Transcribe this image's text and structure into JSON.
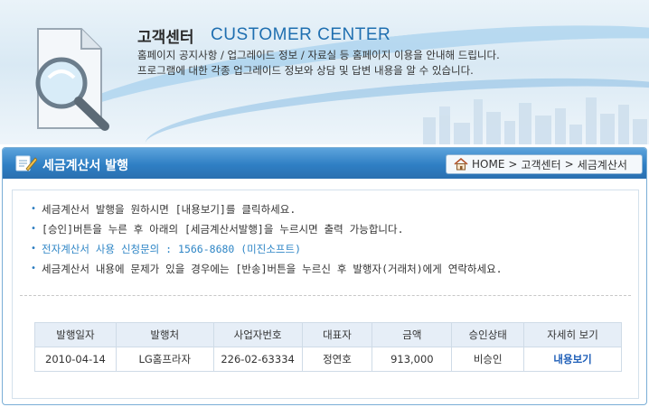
{
  "banner": {
    "title_ko": "고객센터",
    "title_en": "CUSTOMER CENTER",
    "line1": "홈페이지 공지사항 / 업그레이드 정보 / 자료실 등 홈페이지 이용을 안내해 드립니다.",
    "line2": "프로그램에 대한 각종 업그레이드 정보와 상담 및 답변 내용을 알 수 있습니다."
  },
  "panel": {
    "title": "세금계산서 발행",
    "breadcrumb": {
      "home": "HOME",
      "sep1": ">",
      "level1": "고객센터",
      "sep2": ">",
      "level2": "세금계산서"
    }
  },
  "notes": [
    {
      "bullet": "•",
      "text": "세금계산서 발행을 원하시면 [내용보기]를 클릭하세요."
    },
    {
      "bullet": "•",
      "text": "[승인]버튼을 누른 후 아래의 [세금계산서발행]을 누르시면 출력 가능합니다."
    },
    {
      "bullet": "•",
      "text": "전자계산서 사용 신청문의 : 1566-8680 (미진소프트)"
    },
    {
      "bullet": "•",
      "text": "세금계산서 내용에 문제가 있을 경우에는 [반송]버튼을 누르신 후 발행자(거래처)에게 연락하세요."
    }
  ],
  "table": {
    "headers": [
      "발행일자",
      "발행처",
      "사업자번호",
      "대표자",
      "금액",
      "승인상태",
      "자세히 보기"
    ],
    "rows": [
      [
        "2010-04-14",
        "LG홈프라자",
        "226-02-63334",
        "정연호",
        "913,000",
        "비승인",
        "내용보기"
      ]
    ]
  },
  "colors": {
    "header_blue": "#2f7fc4",
    "accent_blue": "#1f6fb0",
    "note_highlight": "#2f86c6",
    "link_blue": "#1f5fb8"
  },
  "icons": {
    "banner": "magnifier-document-icon",
    "panel_header": "document-pen-icon",
    "breadcrumb_home": "home-icon"
  }
}
